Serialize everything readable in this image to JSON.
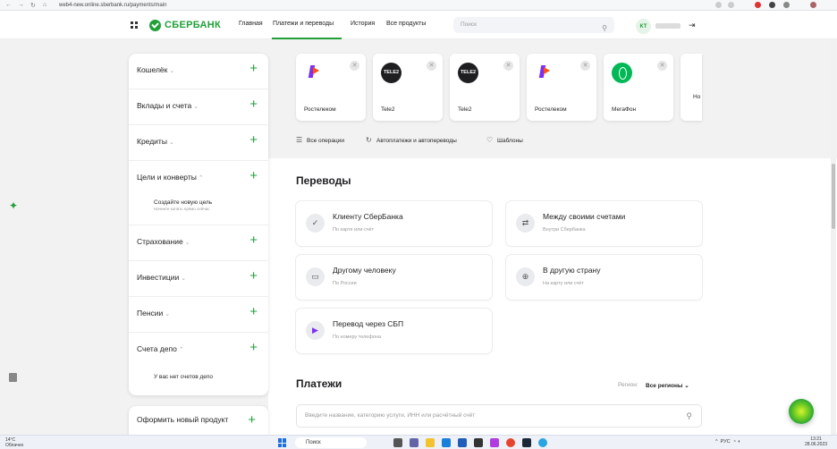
{
  "browser": {
    "url": "web4-new.online.sberbank.ru/payments/main"
  },
  "header": {
    "logo": "СБЕРБАНК",
    "nav": [
      "Главная",
      "Платежи и переводы",
      "История",
      "Все продукты"
    ],
    "active_nav": "Платежи и переводы",
    "search_placeholder": "Поиск",
    "avatar_initials": "КТ"
  },
  "sidebar": {
    "items": [
      "Кошелёк",
      "Вклады и счета",
      "Кредиты",
      "Цели и конверты",
      "Страхование",
      "Инвестиции",
      "Пенсии",
      "Счета депо"
    ],
    "goal_title": "Создайте новую цель",
    "goal_subtitle": "Начните копить прямо сейчас",
    "depo_empty": "У вас нет счетов депо",
    "new_product": "Оформить новый продукт"
  },
  "favorites": [
    {
      "name": "Ростелеком",
      "logo": "rostelecom-logo"
    },
    {
      "name": "Tele2",
      "logo": "tele2-logo",
      "logo_text": "TELE2"
    },
    {
      "name": "Tele2",
      "logo": "tele2-logo",
      "logo_text": "TELE2"
    },
    {
      "name": "Ростелеком",
      "logo": "rostelecom-logo"
    },
    {
      "name": "МегаФон",
      "logo": "megafon-logo"
    }
  ],
  "favorites_more_label": "Но",
  "quick_links": [
    "Все операции",
    "Автоплатежи и автопереводы",
    "Шаблоны"
  ],
  "transfers": {
    "title": "Переводы",
    "cards": [
      {
        "title": "Клиенту СберБанка",
        "subtitle": "По карте или счёт",
        "icon": "sber-icon"
      },
      {
        "title": "Между своими счетами",
        "subtitle": "Внутри Сбербанка",
        "icon": "arrows-icon"
      },
      {
        "title": "Другому человеку",
        "subtitle": "По России",
        "icon": "card-icon"
      },
      {
        "title": "В другую страну",
        "subtitle": "На карту или счёт",
        "icon": "globe-icon"
      },
      {
        "title": "Перевод через СБП",
        "subtitle": "По номеру телефона",
        "icon": "sbp-icon"
      }
    ]
  },
  "payments": {
    "title": "Платежи",
    "region_label": "Регион:",
    "region_value": "Все регионы",
    "search_placeholder": "Введите название, категорию услуги, ИНН или расчётный счёт"
  },
  "taskbar": {
    "weather_temp": "14°C",
    "weather_desc": "Облачно",
    "search_label": "Поиск",
    "lang": "РУС",
    "time": "13:21",
    "date": "28.06.2023"
  },
  "colors": {
    "brand": "#21a038",
    "text": "#1f1f22",
    "muted": "#999999"
  }
}
